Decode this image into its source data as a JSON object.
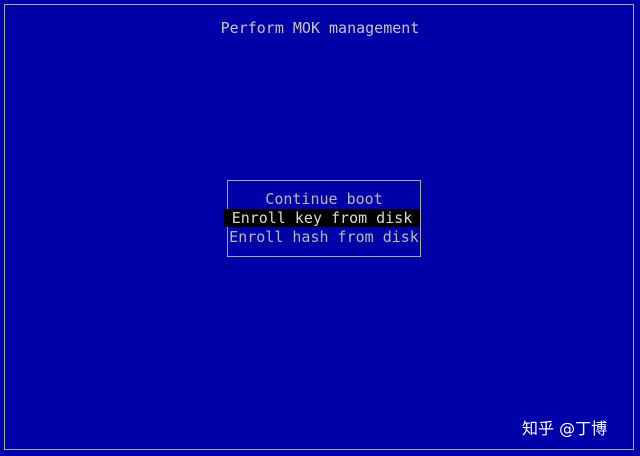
{
  "screen": {
    "title": "Perform MOK management",
    "background_color": "#0000a8",
    "text_color": "#c0c0c0",
    "selection_color": "#000000"
  },
  "menu": {
    "items": [
      {
        "label": "Continue boot",
        "selected": false
      },
      {
        "label": "Enroll key from disk",
        "selected": true
      },
      {
        "label": "Enroll hash from disk",
        "selected": false
      }
    ]
  },
  "watermark": {
    "text": "知乎 @丁博"
  }
}
